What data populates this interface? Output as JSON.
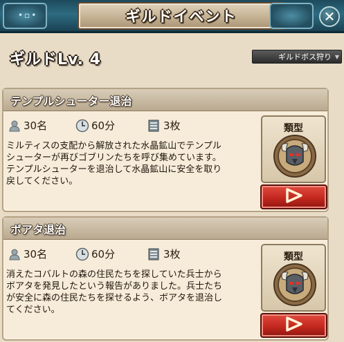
{
  "window": {
    "title": "ギルドイベント",
    "close_icon": "close-icon"
  },
  "header": {
    "guild_level": "ギルドLv. 4",
    "boss_button_label": "ギルドボス狩り"
  },
  "events": [
    {
      "title": "テンプルシューター退治",
      "participants": "30名",
      "duration": "60分",
      "tickets": "3枚",
      "description_lines": [
        "ミルティスの支配から解放された水晶鉱山でテンプル",
        "シューターが再びゴブリンたちを呼び集めています。",
        "テンプルシューターを退治して水晶鉱山に安全を取り",
        "戻してください。"
      ],
      "type_label": "類型",
      "type_icon": "horned-helmet-shield-icon",
      "start_icon": "play-arrow-icon"
    },
    {
      "title": "ボアタ退治",
      "participants": "30名",
      "duration": "60分",
      "tickets": "3枚",
      "description_lines": [
        "消えたコバルトの森の住民たちを探していた兵士から",
        "ボアタを発見したという報告がありました。兵士たち",
        "が安全に森の住民たちを探せるよう、ボアタを退治し",
        "てください。"
      ],
      "type_label": "類型",
      "type_icon": "horned-helmet-shield-icon",
      "start_icon": "play-arrow-icon"
    }
  ],
  "colors": {
    "title_bar": "#2d6b80",
    "panel_bg": "#e9dcc6",
    "card_bg": "#f6ecd9",
    "start_button": "#c4281e"
  }
}
